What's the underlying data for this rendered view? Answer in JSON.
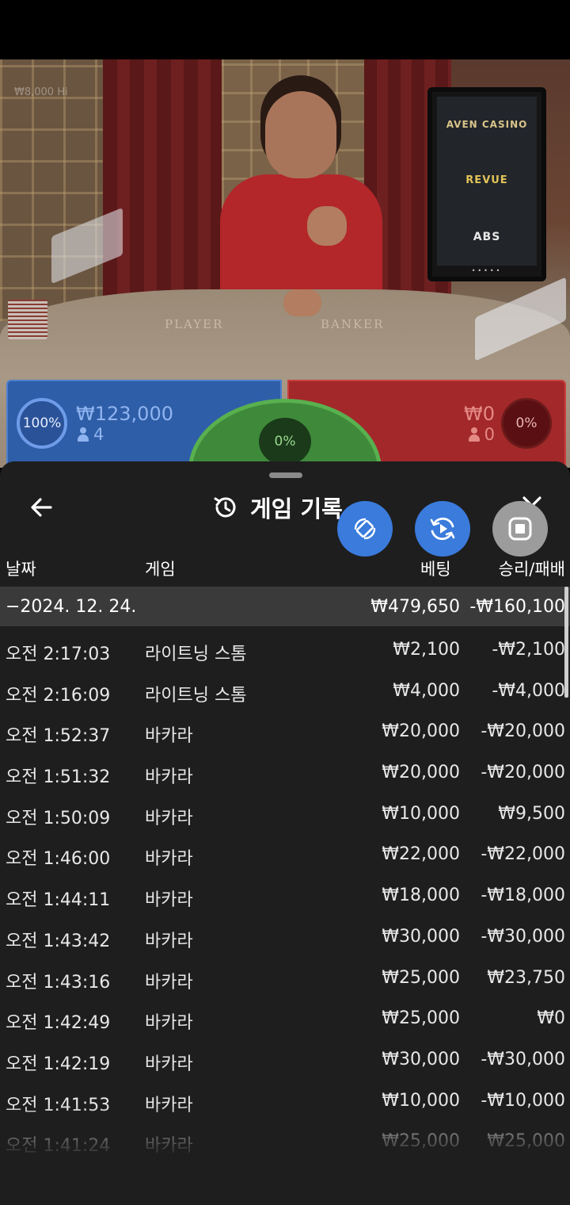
{
  "video": {
    "watermark": "₩8,000 Hi",
    "table_labels": {
      "player": "PLAYER",
      "banker": "BANKER"
    },
    "sponsors": [
      "AVEN CASINO",
      "REVUE",
      "ABS"
    ]
  },
  "bets": {
    "player": {
      "percent": "100%",
      "amount": "₩123,000",
      "count": "4",
      "color": "#2f5ea8"
    },
    "banker": {
      "percent": "0%",
      "amount": "₩0",
      "count": "0",
      "color": "#a3282a"
    },
    "tie": {
      "percent": "0%",
      "color": "#3f8a3a"
    }
  },
  "history": {
    "title": "게임 기록",
    "icons": [
      "back-arrow-icon",
      "history-icon",
      "close-icon",
      "rotate-icon",
      "replay-icon",
      "stop-icon"
    ],
    "columns": {
      "date": "날짜",
      "game": "게임",
      "bet": "베팅",
      "result": "승리/패배"
    },
    "date_group": {
      "label": "−2024. 12. 24.",
      "bet_total": "₩479,650",
      "result_total": "-₩160,100"
    },
    "rows": [
      {
        "time": "오전 2:17:03",
        "game": "라이트닝 스톰",
        "bet": "₩2,100",
        "result": "-₩2,100"
      },
      {
        "time": "오전 2:16:09",
        "game": "라이트닝 스톰",
        "bet": "₩4,000",
        "result": "-₩4,000"
      },
      {
        "time": "오전 1:52:37",
        "game": "바카라",
        "bet": "₩20,000",
        "result": "-₩20,000"
      },
      {
        "time": "오전 1:51:32",
        "game": "바카라",
        "bet": "₩20,000",
        "result": "-₩20,000"
      },
      {
        "time": "오전 1:50:09",
        "game": "바카라",
        "bet": "₩10,000",
        "result": "₩9,500"
      },
      {
        "time": "오전 1:46:00",
        "game": "바카라",
        "bet": "₩22,000",
        "result": "-₩22,000"
      },
      {
        "time": "오전 1:44:11",
        "game": "바카라",
        "bet": "₩18,000",
        "result": "-₩18,000"
      },
      {
        "time": "오전 1:43:42",
        "game": "바카라",
        "bet": "₩30,000",
        "result": "-₩30,000"
      },
      {
        "time": "오전 1:43:16",
        "game": "바카라",
        "bet": "₩25,000",
        "result": "₩23,750"
      },
      {
        "time": "오전 1:42:49",
        "game": "바카라",
        "bet": "₩25,000",
        "result": "₩0"
      },
      {
        "time": "오전 1:42:19",
        "game": "바카라",
        "bet": "₩30,000",
        "result": "-₩30,000"
      },
      {
        "time": "오전 1:41:53",
        "game": "바카라",
        "bet": "₩10,000",
        "result": "-₩10,000"
      },
      {
        "time": "오전 1:41:24",
        "game": "바카라",
        "bet": "₩25,000",
        "result": "₩25,000"
      }
    ]
  }
}
